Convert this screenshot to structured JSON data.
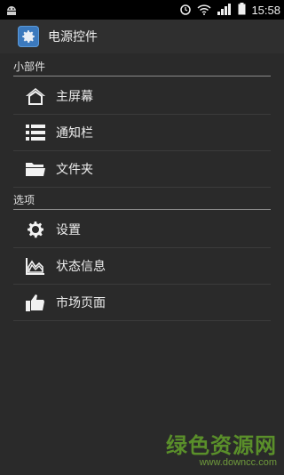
{
  "status_bar": {
    "time": "15:58",
    "icons": [
      "android-icon",
      "alarm-icon",
      "wifi-icon",
      "signal-icon",
      "battery-icon"
    ]
  },
  "action_bar": {
    "title": "电源控件"
  },
  "sections": [
    {
      "header": "小部件",
      "items": [
        {
          "label": "主屏幕",
          "icon": "home-icon"
        },
        {
          "label": "通知栏",
          "icon": "list-icon"
        },
        {
          "label": "文件夹",
          "icon": "folder-icon"
        }
      ]
    },
    {
      "header": "选项",
      "items": [
        {
          "label": "设置",
          "icon": "gear-icon"
        },
        {
          "label": "状态信息",
          "icon": "chart-icon"
        },
        {
          "label": "市场页面",
          "icon": "thumbs-up-icon"
        }
      ]
    }
  ],
  "watermark": {
    "main": "绿色资源网",
    "sub": "www.downcc.com"
  }
}
